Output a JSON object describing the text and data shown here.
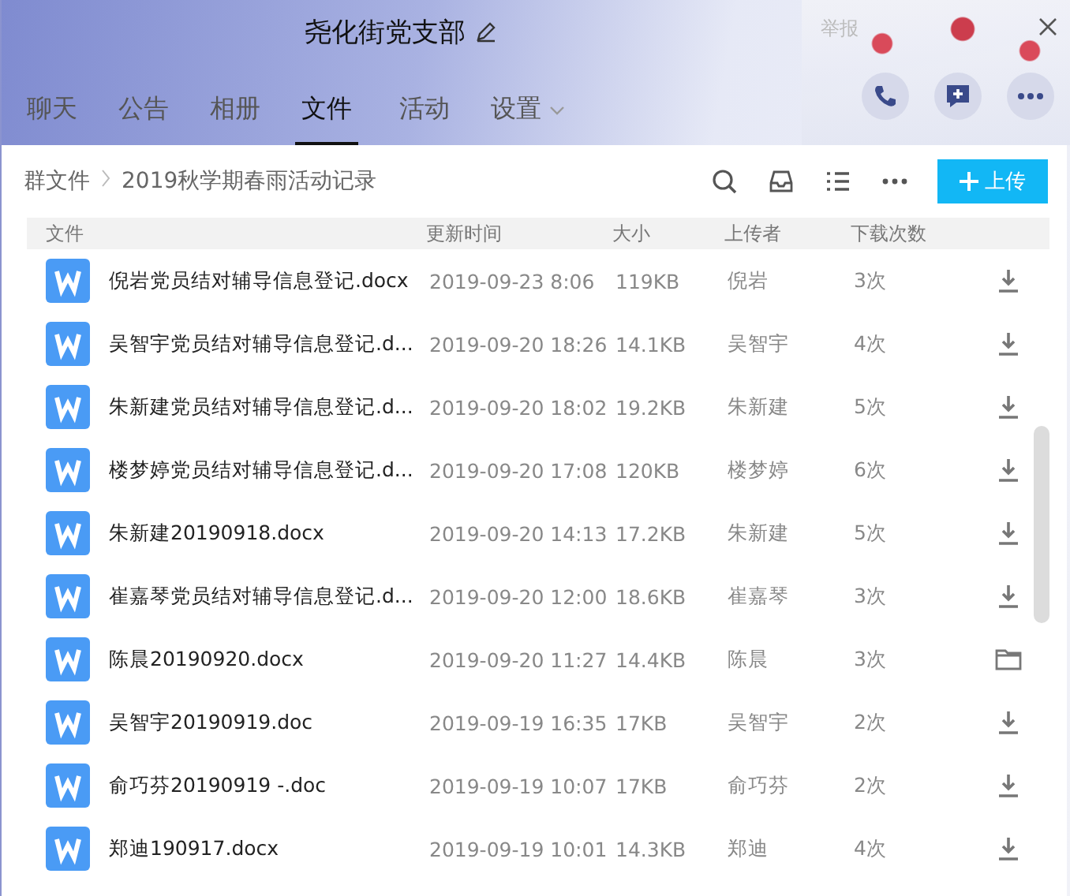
{
  "window": {
    "title": "尧化街党支部",
    "report": "举报"
  },
  "tabs": [
    {
      "label": "聊天",
      "selected": false
    },
    {
      "label": "公告",
      "selected": false
    },
    {
      "label": "相册",
      "selected": false
    },
    {
      "label": "文件",
      "selected": true
    },
    {
      "label": "活动",
      "selected": false
    },
    {
      "label": "设置",
      "selected": false,
      "dropdown": true
    }
  ],
  "breadcrumb": [
    "群文件",
    "2019秋学期春雨活动记录"
  ],
  "upload_button": "上传",
  "table": {
    "columns": [
      "文件",
      "更新时间",
      "大小",
      "上传者",
      "下载次数"
    ],
    "rows": [
      {
        "name": "倪岩党员结对辅导信息登记.docx",
        "time": "2019-09-23 8:06",
        "size": "119KB",
        "uploader": "倪岩",
        "downloads": "3次",
        "kind": "download"
      },
      {
        "name": "吴智宇党员结对辅导信息登记.d...",
        "time": "2019-09-20 18:26",
        "size": "14.1KB",
        "uploader": "吴智宇",
        "downloads": "4次",
        "kind": "download"
      },
      {
        "name": "朱新建党员结对辅导信息登记.d...",
        "time": "2019-09-20 18:02",
        "size": "19.2KB",
        "uploader": "朱新建",
        "downloads": "5次",
        "kind": "download"
      },
      {
        "name": "楼梦婷党员结对辅导信息登记.d...",
        "time": "2019-09-20 17:08",
        "size": "120KB",
        "uploader": "楼梦婷",
        "downloads": "6次",
        "kind": "download"
      },
      {
        "name": "朱新建20190918.docx",
        "time": "2019-09-20 14:13",
        "size": "17.2KB",
        "uploader": "朱新建",
        "downloads": "5次",
        "kind": "download"
      },
      {
        "name": "崔嘉琴党员结对辅导信息登记.d...",
        "time": "2019-09-20 12:00",
        "size": "18.6KB",
        "uploader": "崔嘉琴",
        "downloads": "3次",
        "kind": "download"
      },
      {
        "name": "陈晨20190920.docx",
        "time": "2019-09-20 11:27",
        "size": "14.4KB",
        "uploader": "陈晨",
        "downloads": "3次",
        "kind": "folder"
      },
      {
        "name": "吴智宇20190919.doc",
        "time": "2019-09-19 16:35",
        "size": "17KB",
        "uploader": "吴智宇",
        "downloads": "2次",
        "kind": "download"
      },
      {
        "name": "俞巧芬20190919 -.doc",
        "time": "2019-09-19 10:07",
        "size": "17KB",
        "uploader": "俞巧芬",
        "downloads": "2次",
        "kind": "download"
      },
      {
        "name": "郑迪190917.docx",
        "time": "2019-09-19 10:01",
        "size": "14.3KB",
        "uploader": "郑迪",
        "downloads": "4次",
        "kind": "download"
      }
    ]
  }
}
